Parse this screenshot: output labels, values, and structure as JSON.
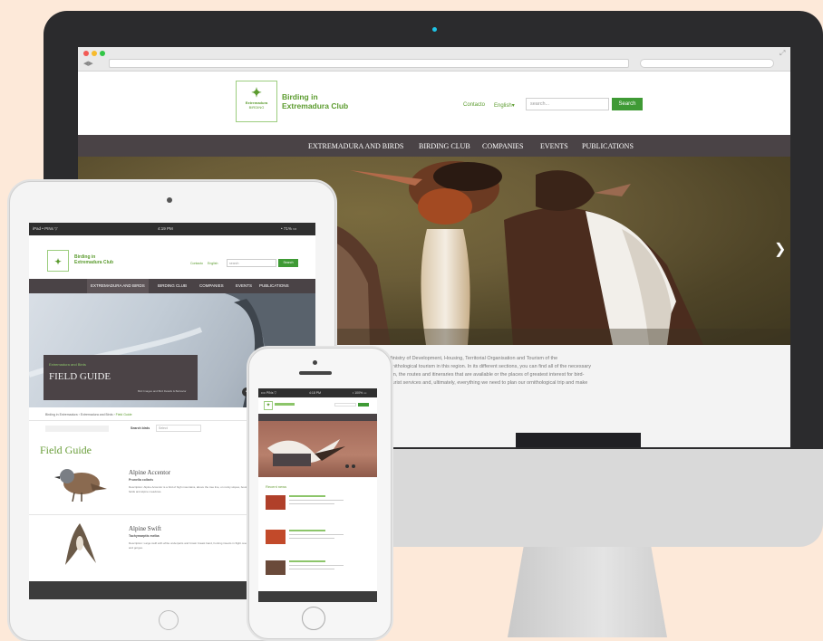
{
  "desktop": {
    "logo_line1": "Extremadura",
    "logo_line2": "BIRDING",
    "site_title_line1": "Birding in",
    "site_title_line2": "Extremadura Club",
    "contact_label": "Contacto",
    "language_label": "English",
    "search_placeholder": "search...",
    "search_button": "Search",
    "nav": [
      "EXTREMADURA AND BIRDS",
      "BIRDING CLUB",
      "COMPANIES",
      "EVENTS",
      "PUBLICATIONS"
    ],
    "body_lines": [
      "Ministry of Development, Housing, Territorial Organisation and Tourism of the",
      "ornithological tourism in this region. In its different sections, you can find all of the necessary",
      "tion, the routes and itineraries that are available or the places of greatest interest for bird-",
      "tourist services and, ultimately, everything we need to plan our ornithological trip and make"
    ]
  },
  "tablet": {
    "status_left": "iPad • PINs ▽",
    "status_center": "4:19 PM",
    "status_right": "• 71% ▭",
    "site_title_line1": "Birding in",
    "site_title_line2": "Extremadura Club",
    "contact_label": "Contacto",
    "language_label": "English",
    "search_placeholder": "search",
    "search_button": "Search",
    "nav": [
      "EXTREMADURA AND BIRDS",
      "BIRDING CLUB",
      "COMPANIES",
      "EVENTS",
      "PUBLICATIONS"
    ],
    "hero_kicker": "Extremadura and Birds",
    "hero_title": "FIELD GUIDE",
    "hero_caption": "Bird Images and Bird Details & Behavior",
    "breadcrumb": [
      "Birding in Extremadura",
      "Extremadura and Birds",
      "Field Guide"
    ],
    "filter_label": "Search birds",
    "filter_value": "Select",
    "page_title": "Field Guide",
    "birds": [
      {
        "name": "Alpine Accentor",
        "scientific": "Prunella collaris",
        "description": "Description: Alpine Accentor is a bird of high mountains, above the tree line, on rocky slopes, boulder fields and alpine meadows."
      },
      {
        "name": "Alpine Swift",
        "scientific": "Tachymarptis melba",
        "description": "Description: Large swift with white underparts and brown breast band, hunting insects in flight over cliffs and gorges."
      }
    ]
  },
  "phone": {
    "status_left": "•••• PINs ▽",
    "status_center": "4:18 PM",
    "status_right": "• 100% ▭",
    "section_title": "Recent news"
  }
}
